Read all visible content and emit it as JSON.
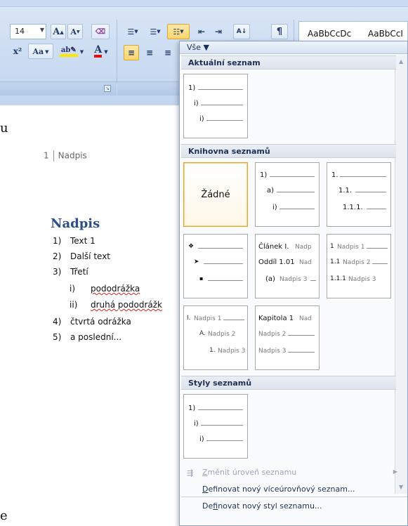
{
  "ribbon": {
    "font_size": "14",
    "grow_font": "A",
    "shrink_font": "A",
    "change_case": "Aa",
    "superscript": "x²",
    "highlight_label": "ab",
    "font_color_label": "A",
    "sort_label": "A↓",
    "show_marks": "¶",
    "styles": [
      "AaBbCcDc",
      "AaBbCcI"
    ]
  },
  "document": {
    "edge_letters": [
      "u",
      "e"
    ],
    "heading_tag_number": "1",
    "heading_tag_text": "Nadpis",
    "heading": "Nadpis",
    "list": [
      {
        "num": "1)",
        "text": "Text 1"
      },
      {
        "num": "2)",
        "text": "Další text"
      },
      {
        "num": "3)",
        "text": "Třetí"
      },
      {
        "num": "i)",
        "text": "pododrážka"
      },
      {
        "num": "ii)",
        "text": "druhá pododrážk"
      },
      {
        "num": "4)",
        "text": "čtvrtá odrážka"
      },
      {
        "num": "5)",
        "text": "a poslední..."
      }
    ]
  },
  "gallery": {
    "filter": "Vše ▼",
    "sections": {
      "current": "Aktuální seznam",
      "library": "Knihovna seznamů",
      "styles": "Styly seznamů"
    },
    "current_tile": {
      "l1": "1)",
      "l2": "i)",
      "l3": "i)"
    },
    "none_label": "Žádné",
    "tile_num_paren": {
      "l1": "1)",
      "l2": "a)",
      "l3": "i)"
    },
    "tile_decimal": {
      "l1": "1.",
      "l2": "1.1.",
      "l3": "1.1.1."
    },
    "tile_bullets": {
      "l1": "❖",
      "l2": "➤",
      "l3": "▪"
    },
    "tile_article": {
      "l1": "Článek I.",
      "l1b": "Nadp",
      "l2": "Oddíl 1.01",
      "l2b": "Nad",
      "l3": "(a)",
      "l3b": "Nadpis 3"
    },
    "tile_headings_num": {
      "l1": "1",
      "l1b": "Nadpis 1",
      "l2": "1.1",
      "l2b": "Nadpis 2",
      "l3": "1.1.1",
      "l3b": "Nadpis 3"
    },
    "tile_roman": {
      "l1": "I.",
      "l1b": "Nadpis 1",
      "l2": "A.",
      "l2b": "Nadpis 2",
      "l3": "1.",
      "l3b": "Nadpis 3"
    },
    "tile_chapter": {
      "l1": "Kapitola 1",
      "l1b": "Nad",
      "l2": "Nadpis 2",
      "l3": "Nadpis 3"
    },
    "styles_tile": {
      "l1": "1)",
      "l2": "i)",
      "l3": "i)"
    },
    "menu": {
      "change_level_pre": "Z",
      "change_level_rest": "měnit úroveň seznamu",
      "define_multilevel_pre": "D",
      "define_multilevel_rest": "efinovat nový víceúrovňový seznam...",
      "define_style_pre": "De",
      "define_style_u": "f",
      "define_style_rest": "inovat nový styl seznamu..."
    }
  }
}
